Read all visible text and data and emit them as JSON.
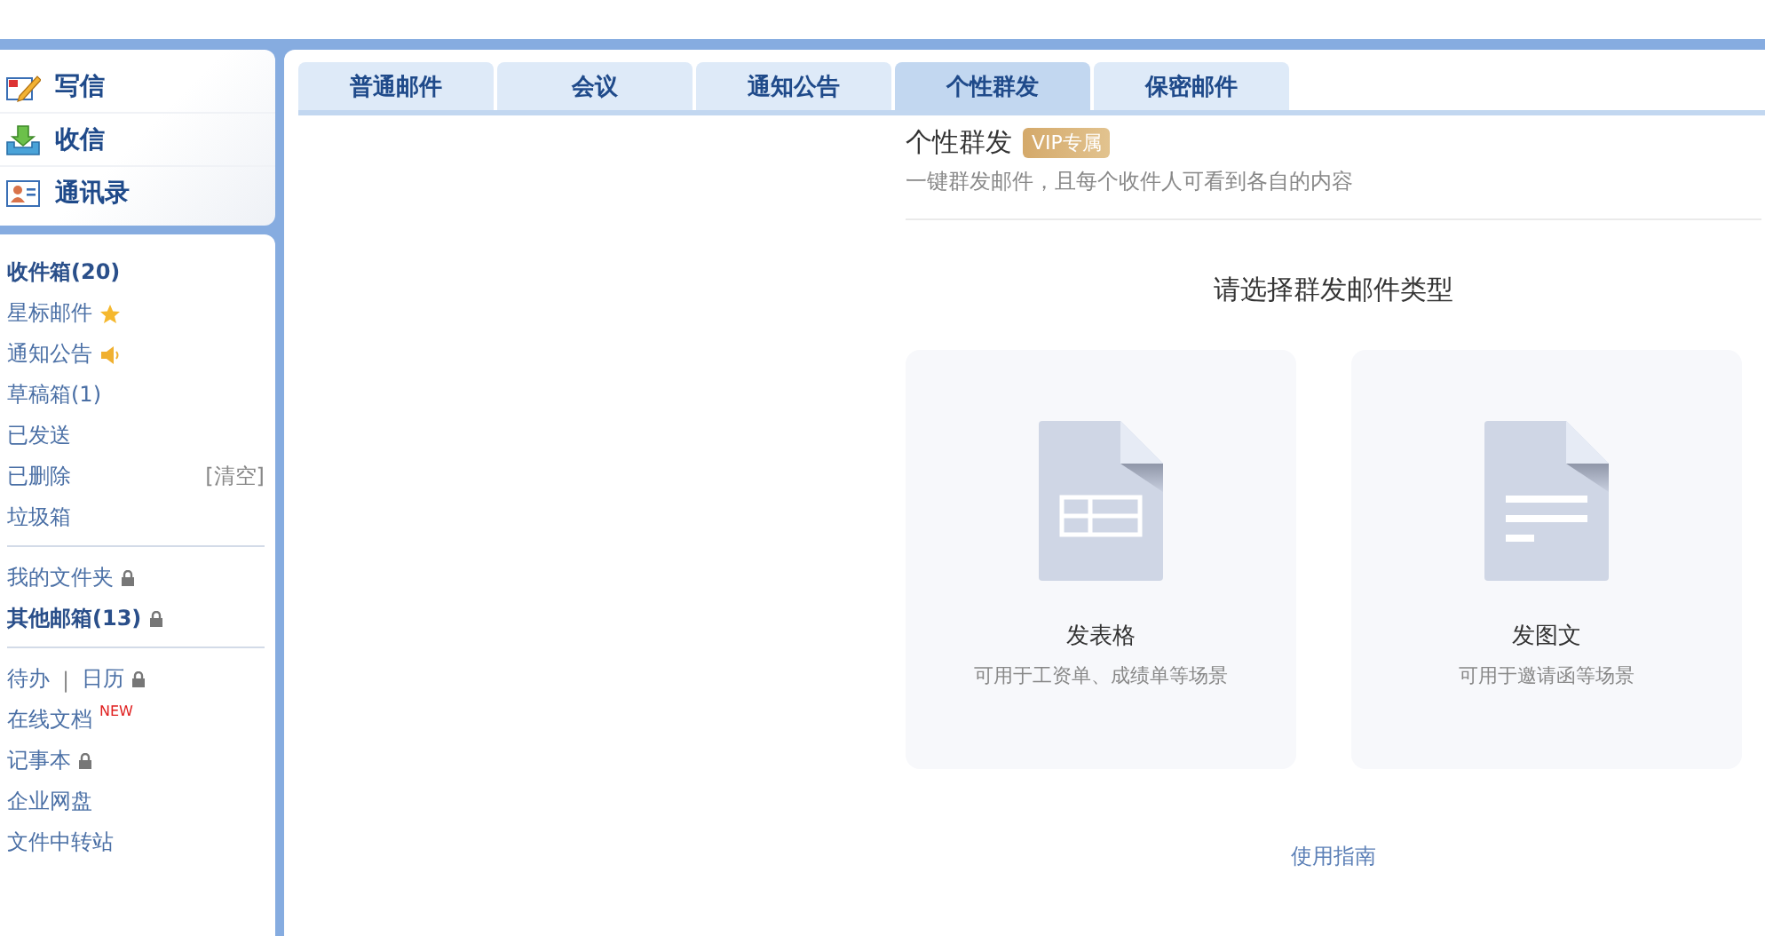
{
  "quick_actions": [
    {
      "kind": "compose",
      "label": "写信"
    },
    {
      "kind": "inbox",
      "label": "收信"
    },
    {
      "kind": "contacts",
      "label": "通讯录"
    }
  ],
  "folder_groups": [
    [
      {
        "kind": "plain",
        "label": "收件箱(20)",
        "bold": true
      },
      {
        "kind": "star",
        "label": "星标邮件",
        "bold": false
      },
      {
        "kind": "speaker",
        "label": "通知公告",
        "bold": false
      },
      {
        "kind": "plain",
        "label": "草稿箱(1)",
        "bold": false
      },
      {
        "kind": "plain",
        "label": "已发送",
        "bold": false
      },
      {
        "kind": "action",
        "label": "已删除",
        "bold": false,
        "action": "[清空]"
      },
      {
        "kind": "plain",
        "label": "垃圾箱",
        "bold": false
      }
    ],
    [
      {
        "kind": "lock",
        "label": "我的文件夹",
        "bold": false
      },
      {
        "kind": "lock",
        "label": "其他邮箱(13)",
        "bold": true
      }
    ],
    [
      {
        "kind": "pair",
        "label": "待办",
        "second": "日历",
        "separator": "|",
        "bold": false
      },
      {
        "kind": "new",
        "label": "在线文档",
        "badge": "NEW",
        "bold": false
      },
      {
        "kind": "lock",
        "label": "记事本",
        "bold": false
      },
      {
        "kind": "plain",
        "label": "企业网盘",
        "bold": false
      },
      {
        "kind": "plain",
        "label": "文件中转站",
        "bold": false
      }
    ]
  ],
  "tabs": [
    {
      "label": "普通邮件",
      "selected": false
    },
    {
      "label": "会议",
      "selected": false
    },
    {
      "label": "通知公告",
      "selected": false
    },
    {
      "label": "个性群发",
      "selected": true
    },
    {
      "label": "保密邮件",
      "selected": false
    }
  ],
  "panel": {
    "title": "个性群发",
    "badge": "VIP专属",
    "subtitle": "一键群发邮件，且每个收件人可看到各自的内容",
    "heading": "请选择群发邮件类型",
    "cards": [
      {
        "kind": "table",
        "title": "发表格",
        "description": "可用于工资单、成绩单等场景"
      },
      {
        "kind": "text",
        "title": "发图文",
        "description": "可用于邀请函等场景"
      }
    ],
    "guide_link": "使用指南"
  }
}
